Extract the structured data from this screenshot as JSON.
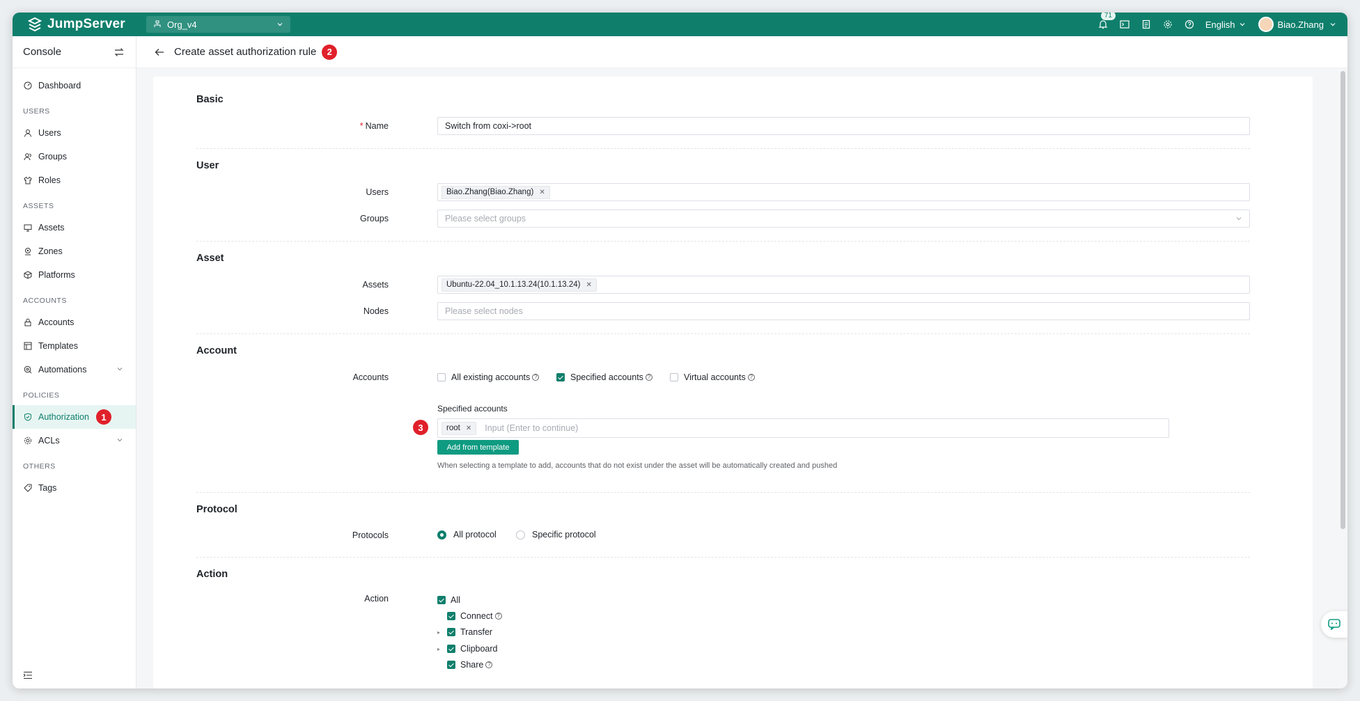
{
  "app": {
    "name": "JumpServer"
  },
  "org": {
    "name": "Org_v4"
  },
  "topbar": {
    "notifications": "71",
    "language": "English",
    "user": "Biao.Zhang"
  },
  "sidebar": {
    "title": "Console",
    "dashboard": "Dashboard",
    "sections": {
      "users": "USERS",
      "assets": "ASSETS",
      "accounts": "ACCOUNTS",
      "policies": "POLICIES",
      "others": "OTHERS"
    },
    "items": {
      "users": "Users",
      "groups": "Groups",
      "roles": "Roles",
      "assets": "Assets",
      "zones": "Zones",
      "platforms": "Platforms",
      "accounts": "Accounts",
      "templates": "Templates",
      "automations": "Automations",
      "authorization": "Authorization",
      "acls": "ACLs",
      "tags": "Tags"
    }
  },
  "markers": {
    "one": "1",
    "two": "2",
    "three": "3"
  },
  "header": {
    "title": "Create asset authorization rule"
  },
  "form": {
    "basic": {
      "title": "Basic",
      "name_label": "Name",
      "name_value": "Switch from coxi->root"
    },
    "user": {
      "title": "User",
      "users_label": "Users",
      "users_tag": "Biao.Zhang(Biao.Zhang)",
      "groups_label": "Groups",
      "groups_placeholder": "Please select groups"
    },
    "asset": {
      "title": "Asset",
      "assets_label": "Assets",
      "assets_tag": "Ubuntu-22.04_10.1.13.24(10.1.13.24)",
      "nodes_label": "Nodes",
      "nodes_placeholder": "Please select nodes"
    },
    "account": {
      "title": "Account",
      "accounts_label": "Accounts",
      "opt_all": "All existing accounts",
      "opt_specified": "Specified accounts",
      "opt_virtual": "Virtual accounts",
      "specified_title": "Specified accounts",
      "specified_tag": "root",
      "specified_placeholder": "Input (Enter to continue)",
      "add_template": "Add from template",
      "hint": "When selecting a template to add, accounts that do not exist under the asset will be automatically created and pushed"
    },
    "protocol": {
      "title": "Protocol",
      "label": "Protocols",
      "opt_all": "All protocol",
      "opt_specific": "Specific protocol"
    },
    "action": {
      "title": "Action",
      "label": "Action",
      "all": "All",
      "connect": "Connect",
      "transfer": "Transfer",
      "clipboard": "Clipboard",
      "share": "Share"
    }
  }
}
